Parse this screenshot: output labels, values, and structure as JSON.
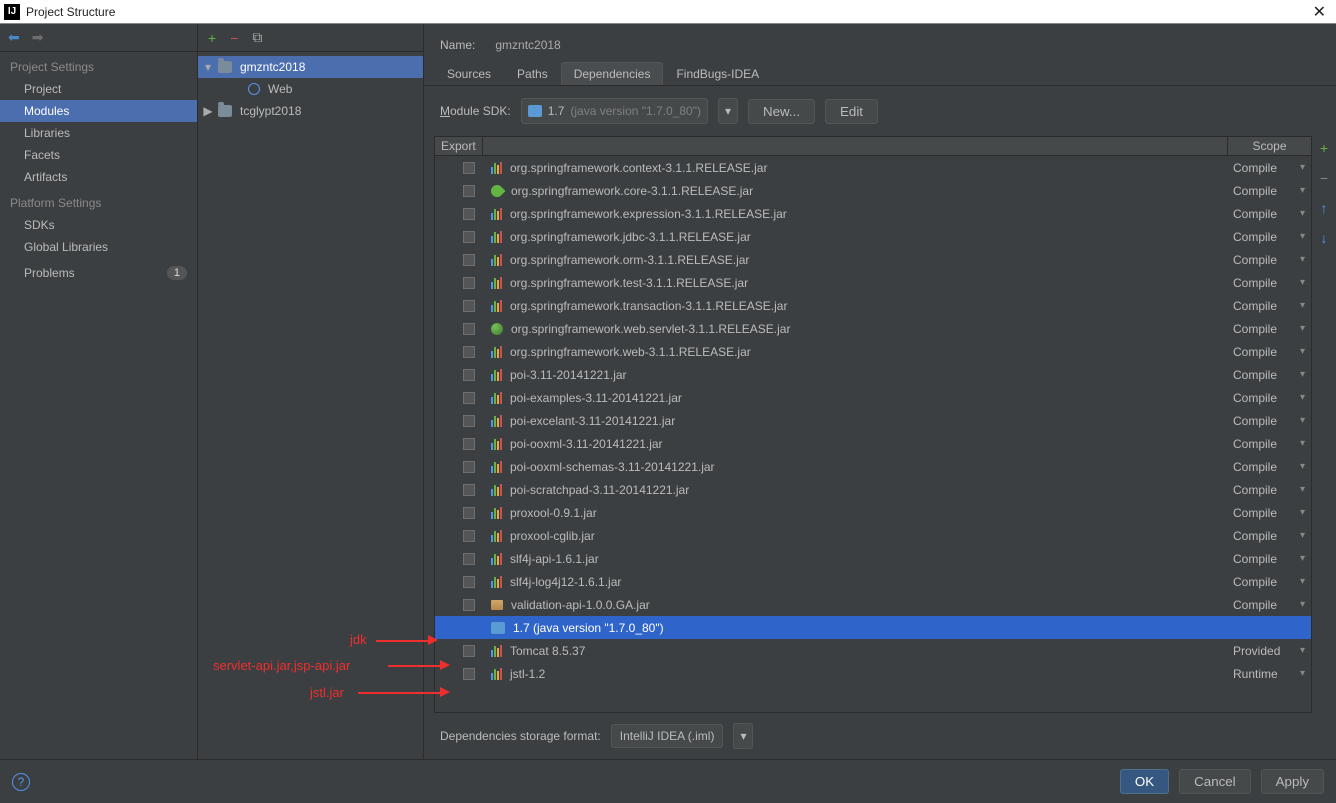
{
  "window": {
    "title": "Project Structure",
    "app_glyph": "IJ"
  },
  "sidebar": {
    "nav_back": "←",
    "nav_fwd": "→",
    "section1": "Project Settings",
    "items1": [
      "Project",
      "Modules",
      "Libraries",
      "Facets",
      "Artifacts"
    ],
    "section2": "Platform Settings",
    "items2": [
      "SDKs",
      "Global Libraries"
    ],
    "problems_label": "Problems",
    "problems_count": "1"
  },
  "tree": {
    "toolbar": {
      "add": "+",
      "remove": "−",
      "copy": "⧉"
    },
    "nodes": [
      {
        "label": "gmzntc2018",
        "expanded": true,
        "indent": 0,
        "icon": "folder",
        "selected": true
      },
      {
        "label": "Web",
        "expanded": false,
        "indent": 1,
        "icon": "web",
        "selected": false
      },
      {
        "label": "tcglypt2018",
        "expanded": false,
        "indent": 0,
        "icon": "folder",
        "selected": false,
        "twisty": "▶"
      }
    ]
  },
  "name_row": {
    "label": "Name:",
    "value": "gmzntc2018"
  },
  "tabs": [
    "Sources",
    "Paths",
    "Dependencies",
    "FindBugs-IDEA"
  ],
  "active_tab": 2,
  "module_sdk": {
    "label": "Module SDK:",
    "sdk_name": "1.7",
    "sdk_version": "(java version \"1.7.0_80\")",
    "new_btn": "New...",
    "edit_btn": "Edit"
  },
  "dep_header": {
    "export": "Export",
    "scope": "Scope"
  },
  "dep_rows": [
    {
      "icon": "lib",
      "name": "org.springframework.context-3.1.1.RELEASE.jar",
      "scope": "Compile"
    },
    {
      "icon": "leaf",
      "name": "org.springframework.core-3.1.1.RELEASE.jar",
      "scope": "Compile"
    },
    {
      "icon": "lib",
      "name": "org.springframework.expression-3.1.1.RELEASE.jar",
      "scope": "Compile"
    },
    {
      "icon": "lib",
      "name": "org.springframework.jdbc-3.1.1.RELEASE.jar",
      "scope": "Compile"
    },
    {
      "icon": "lib",
      "name": "org.springframework.orm-3.1.1.RELEASE.jar",
      "scope": "Compile"
    },
    {
      "icon": "lib",
      "name": "org.springframework.test-3.1.1.RELEASE.jar",
      "scope": "Compile"
    },
    {
      "icon": "lib",
      "name": "org.springframework.transaction-3.1.1.RELEASE.jar",
      "scope": "Compile"
    },
    {
      "icon": "globe",
      "name": "org.springframework.web.servlet-3.1.1.RELEASE.jar",
      "scope": "Compile"
    },
    {
      "icon": "lib",
      "name": "org.springframework.web-3.1.1.RELEASE.jar",
      "scope": "Compile"
    },
    {
      "icon": "lib",
      "name": "poi-3.11-20141221.jar",
      "scope": "Compile"
    },
    {
      "icon": "lib",
      "name": "poi-examples-3.11-20141221.jar",
      "scope": "Compile"
    },
    {
      "icon": "lib",
      "name": "poi-excelant-3.11-20141221.jar",
      "scope": "Compile"
    },
    {
      "icon": "lib",
      "name": "poi-ooxml-3.11-20141221.jar",
      "scope": "Compile"
    },
    {
      "icon": "lib",
      "name": "poi-ooxml-schemas-3.11-20141221.jar",
      "scope": "Compile"
    },
    {
      "icon": "lib",
      "name": "poi-scratchpad-3.11-20141221.jar",
      "scope": "Compile"
    },
    {
      "icon": "lib",
      "name": "proxool-0.9.1.jar",
      "scope": "Compile"
    },
    {
      "icon": "lib",
      "name": "proxool-cglib.jar",
      "scope": "Compile"
    },
    {
      "icon": "lib",
      "name": "slf4j-api-1.6.1.jar",
      "scope": "Compile"
    },
    {
      "icon": "lib",
      "name": "slf4j-log4j12-1.6.1.jar",
      "scope": "Compile"
    },
    {
      "icon": "box",
      "name": "validation-api-1.0.0.GA.jar",
      "scope": "Compile"
    },
    {
      "icon": "jdk",
      "name": "1.7 (java version \"1.7.0_80\")",
      "scope": "",
      "selected": true,
      "noCheckbox": true
    },
    {
      "icon": "lib",
      "name": "Tomcat 8.5.37",
      "scope": "Provided"
    },
    {
      "icon": "lib",
      "name": "jstl-1.2",
      "scope": "Runtime"
    }
  ],
  "side_tools": {
    "add": "+",
    "remove": "−",
    "up": "↑",
    "down": "↓"
  },
  "storage": {
    "label": "Dependencies storage format:",
    "value": "IntelliJ IDEA (.iml)"
  },
  "footer": {
    "help": "?",
    "ok": "OK",
    "cancel": "Cancel",
    "apply": "Apply"
  },
  "annotations": {
    "a1": "jdk",
    "a2": "servlet-api.jar,jsp-api.jar",
    "a3": "jstl.jar"
  }
}
